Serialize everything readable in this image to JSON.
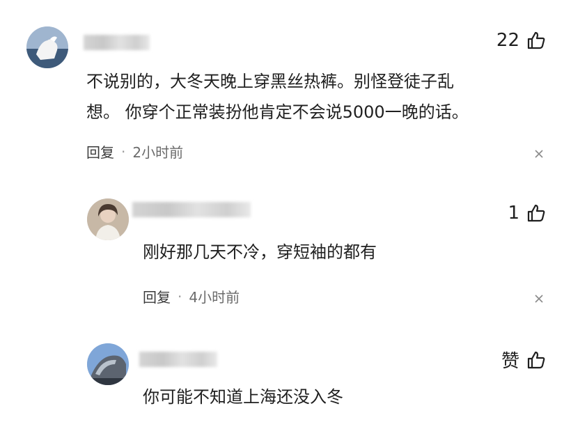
{
  "comments": [
    {
      "likes": "22",
      "text": "不说别的，大冬天晚上穿黑丝热裤。别怪登徒子乱\n想。 你穿个正常装扮他肯定不会说5000一晚的话。",
      "reply_label": "回复",
      "separator": "·",
      "time": "2小时前"
    },
    {
      "likes": "1",
      "text": "刚好那几天不冷，穿短袖的都有",
      "reply_label": "回复",
      "separator": "·",
      "time": "4小时前"
    },
    {
      "likes": "赞",
      "text": "你可能不知道上海还没入冬"
    }
  ],
  "icons": {
    "like": "thumbs-up-icon",
    "close": "close-icon"
  }
}
